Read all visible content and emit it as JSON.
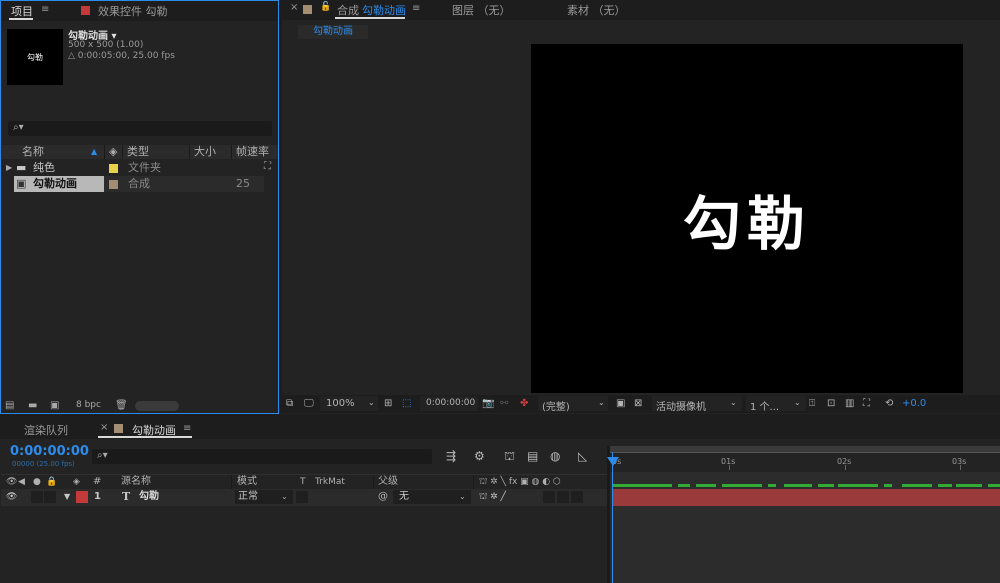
{
  "project_panel": {
    "tabs": [
      {
        "label": "项目",
        "active": true
      },
      {
        "label": "效果控件 勾勒",
        "active": false
      }
    ],
    "menu_icon": "≡",
    "selected_item": {
      "name": "勾勒动画 ▾",
      "size": "500 x 500 (1.00)",
      "duration": "△ 0:00:05:00, 25.00 fps",
      "thumb_text": "勾勒"
    },
    "search_icon": "⌕▾",
    "columns": [
      "名称",
      "类型",
      "大小",
      "帧速率"
    ],
    "rows": [
      {
        "name": "纯色",
        "type": "文件夹",
        "size": "",
        "fps": "",
        "swatch": "#e8d24a",
        "kind": "folder"
      },
      {
        "name": "勾勒动画",
        "type": "合成",
        "size": "",
        "fps": "25",
        "swatch": "#a38e74",
        "kind": "comp"
      }
    ],
    "footer": {
      "bpc": "8 bpc"
    }
  },
  "comp_panel": {
    "tabs": [
      {
        "label": "合成",
        "active": false
      },
      {
        "label": "勾勒动画",
        "active": true
      },
      {
        "label": "图层 （无）",
        "active": false
      },
      {
        "label": "素材 （无）",
        "active": false
      }
    ],
    "close_glyph": "×",
    "lock_glyph": "🔓",
    "menu_icon": "≡",
    "subtab": "勾勒动画",
    "canvas_text": "勾勒",
    "toolbar": {
      "zoom": "100%",
      "timecode": "0:00:00:00",
      "resolution": "(完整)",
      "camera": "活动摄像机",
      "views": "1 个...",
      "exposure": "+0.0"
    }
  },
  "timeline": {
    "tabs": [
      {
        "label": "渲染队列",
        "active": false
      },
      {
        "label": "勾勒动画",
        "active": true
      }
    ],
    "close_glyph": "×",
    "menu_icon": "≡",
    "timecode": "0:00:00:00",
    "timecode_sub": "00000 (25.00 fps)",
    "search_icon": "⌕▾",
    "headers": {
      "hash": "#",
      "source_name": "源名称",
      "mode": "模式",
      "t": "T",
      "trkmat": "TrkMat",
      "parent": "父级"
    },
    "layer": {
      "index": "1",
      "type_glyph": "T",
      "name": "勾勒",
      "mode": "正常",
      "parent": "无",
      "label_color": "#c43a3a"
    },
    "ruler": [
      "0s",
      "01s",
      "02s",
      "03s"
    ]
  },
  "colors": {
    "accent": "#2d8ceb",
    "panel_bg": "#232323",
    "layer_bar": "#9b3a3a",
    "green_line": "#33aa33"
  }
}
